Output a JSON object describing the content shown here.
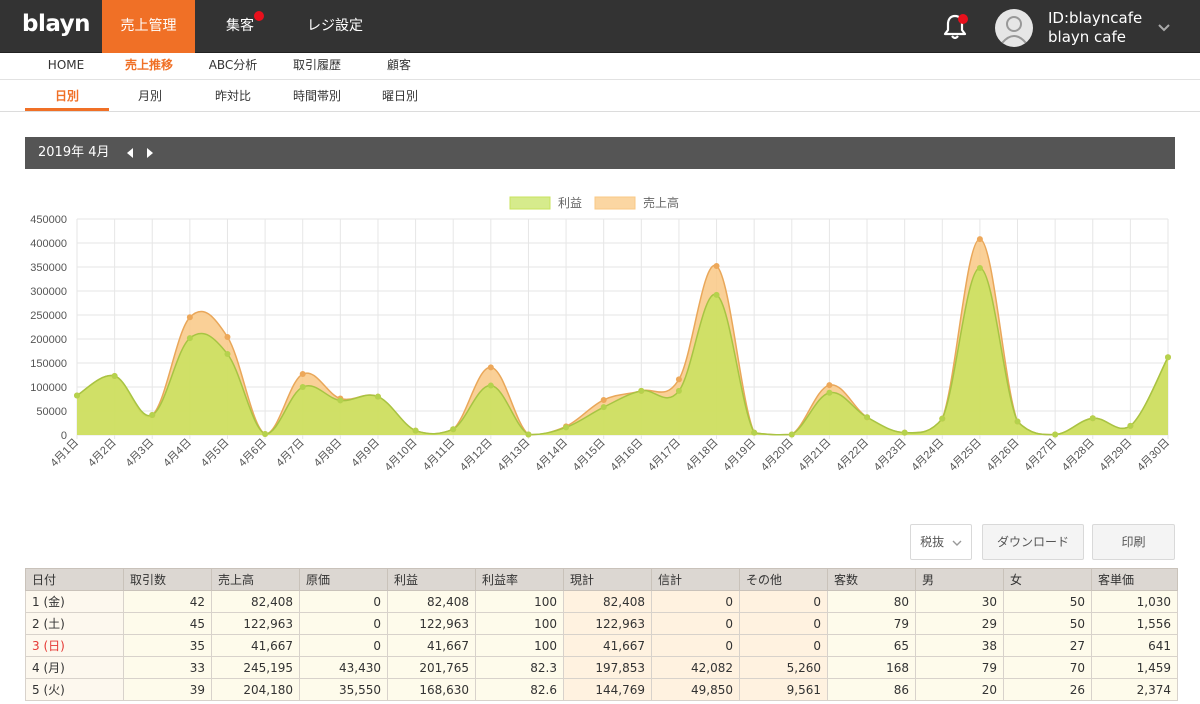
{
  "header": {
    "brand": "blayn",
    "nav": [
      {
        "label": "売上管理",
        "active": true,
        "badge": false
      },
      {
        "label": "集客",
        "active": false,
        "badge": true
      },
      {
        "label": "レジ設定",
        "active": false,
        "badge": false
      }
    ],
    "notification_icon": "bell-icon",
    "account": {
      "id_label": "ID:blayncafe",
      "name": "blayn cafe"
    }
  },
  "subnav": {
    "primary": [
      "HOME",
      "売上推移",
      "ABC分析",
      "取引履歴",
      "顧客"
    ],
    "primary_active": 1,
    "secondary": [
      "日別",
      "月別",
      "昨対比",
      "時間帯別",
      "曜日別"
    ],
    "secondary_active": 0
  },
  "period": {
    "label": "2019年 4月"
  },
  "controls": {
    "tax_select": "税抜",
    "download": "ダウンロード",
    "print": "印刷"
  },
  "colors": {
    "accent": "#f07026",
    "profit_fill": "#c8e35e",
    "sales_fill": "#f9c885"
  },
  "chart_data": {
    "type": "area",
    "x": [
      "4月1日",
      "4月2日",
      "4月3日",
      "4月4日",
      "4月5日",
      "4月6日",
      "4月7日",
      "4月8日",
      "4月9日",
      "4月10日",
      "4月11日",
      "4月12日",
      "4月13日",
      "4月14日",
      "4月15日",
      "4月16日",
      "4月17日",
      "4月18日",
      "4月19日",
      "4月20日",
      "4月21日",
      "4月22日",
      "4月23日",
      "4月24日",
      "4月25日",
      "4月26日",
      "4月27日",
      "4月28日",
      "4月29日",
      "4月30日"
    ],
    "series": [
      {
        "name": "利益",
        "values": [
          82408,
          122963,
          41667,
          201765,
          168630,
          2000,
          100000,
          72000,
          80000,
          9000,
          12000,
          103000,
          1000,
          16000,
          58000,
          92000,
          92000,
          292000,
          5000,
          1000,
          88000,
          37000,
          5000,
          34000,
          348000,
          28000,
          1000,
          35000,
          19000,
          162000
        ]
      },
      {
        "name": "売上高",
        "values": [
          82408,
          122963,
          41667,
          245195,
          204180,
          2000,
          127000,
          76000,
          80000,
          9000,
          12000,
          141000,
          1000,
          18000,
          73000,
          92000,
          116000,
          352000,
          5000,
          1000,
          104000,
          37000,
          5000,
          34000,
          408000,
          28000,
          1000,
          35000,
          19000,
          162000
        ]
      }
    ],
    "ylim": [
      0,
      450000
    ],
    "yticks": [
      0,
      50000,
      100000,
      150000,
      200000,
      250000,
      300000,
      350000,
      400000,
      450000
    ],
    "legend": "top-center",
    "grid": true
  },
  "table": {
    "columns": [
      "日付",
      "取引数",
      "売上高",
      "原価",
      "利益",
      "利益率",
      "現計",
      "信計",
      "その他",
      "客数",
      "男",
      "女",
      "客単価"
    ],
    "rows": [
      {
        "cells": [
          "1 (金)",
          "42",
          "82,408",
          "0",
          "82,408",
          "100",
          "82,408",
          "0",
          "0",
          "80",
          "30",
          "50",
          "1,030"
        ],
        "sunday": false
      },
      {
        "cells": [
          "2 (土)",
          "45",
          "122,963",
          "0",
          "122,963",
          "100",
          "122,963",
          "0",
          "0",
          "79",
          "29",
          "50",
          "1,556"
        ],
        "sunday": false
      },
      {
        "cells": [
          "3 (日)",
          "35",
          "41,667",
          "0",
          "41,667",
          "100",
          "41,667",
          "0",
          "0",
          "65",
          "38",
          "27",
          "641"
        ],
        "sunday": true
      },
      {
        "cells": [
          "4 (月)",
          "33",
          "245,195",
          "43,430",
          "201,765",
          "82.3",
          "197,853",
          "42,082",
          "5,260",
          "168",
          "79",
          "70",
          "1,459"
        ],
        "sunday": false
      },
      {
        "cells": [
          "5 (火)",
          "39",
          "204,180",
          "35,550",
          "168,630",
          "82.6",
          "144,769",
          "49,850",
          "9,561",
          "86",
          "20",
          "26",
          "2,374"
        ],
        "sunday": false
      }
    ]
  }
}
